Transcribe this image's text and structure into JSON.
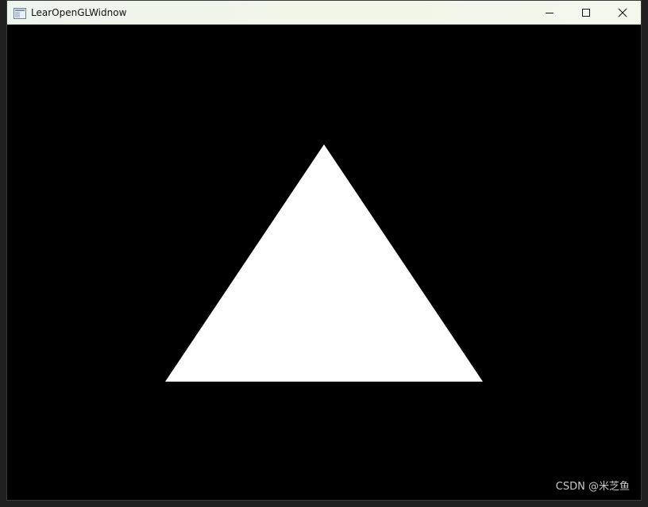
{
  "window": {
    "title": "LearOpenGLWidnow",
    "app_icon": "window-app-icon",
    "controls": {
      "minimize_icon": "minimize-icon",
      "maximize_icon": "maximize-icon",
      "close_icon": "close-icon"
    }
  },
  "scene": {
    "background_color": "#000000",
    "shape": "triangle",
    "shape_color": "#ffffff"
  },
  "watermark": {
    "text": "CSDN @米芝鱼"
  }
}
